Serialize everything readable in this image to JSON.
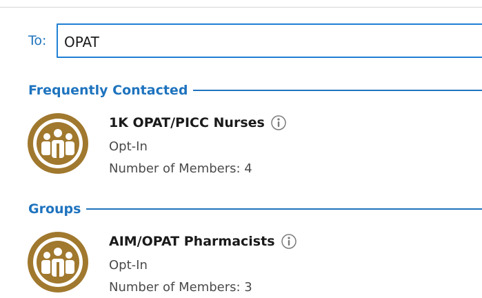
{
  "recipient": {
    "label": "To:",
    "value": "OPAT"
  },
  "sections": [
    {
      "title": "Frequently Contacted",
      "contacts": [
        {
          "name": "1K OPAT/PICC Nurses",
          "subscription": "Opt-In",
          "members": "Number of Members: 4",
          "icon": "group-avatar-icon"
        }
      ]
    },
    {
      "title": "Groups",
      "contacts": [
        {
          "name": "AIM/OPAT Pharmacists",
          "subscription": "Opt-In",
          "members": "Number of Members: 3",
          "icon": "group-avatar-icon"
        }
      ]
    }
  ],
  "colors": {
    "accent": "#1e73be",
    "avatar": "#a0782e",
    "input_border": "#1f7fd4"
  }
}
